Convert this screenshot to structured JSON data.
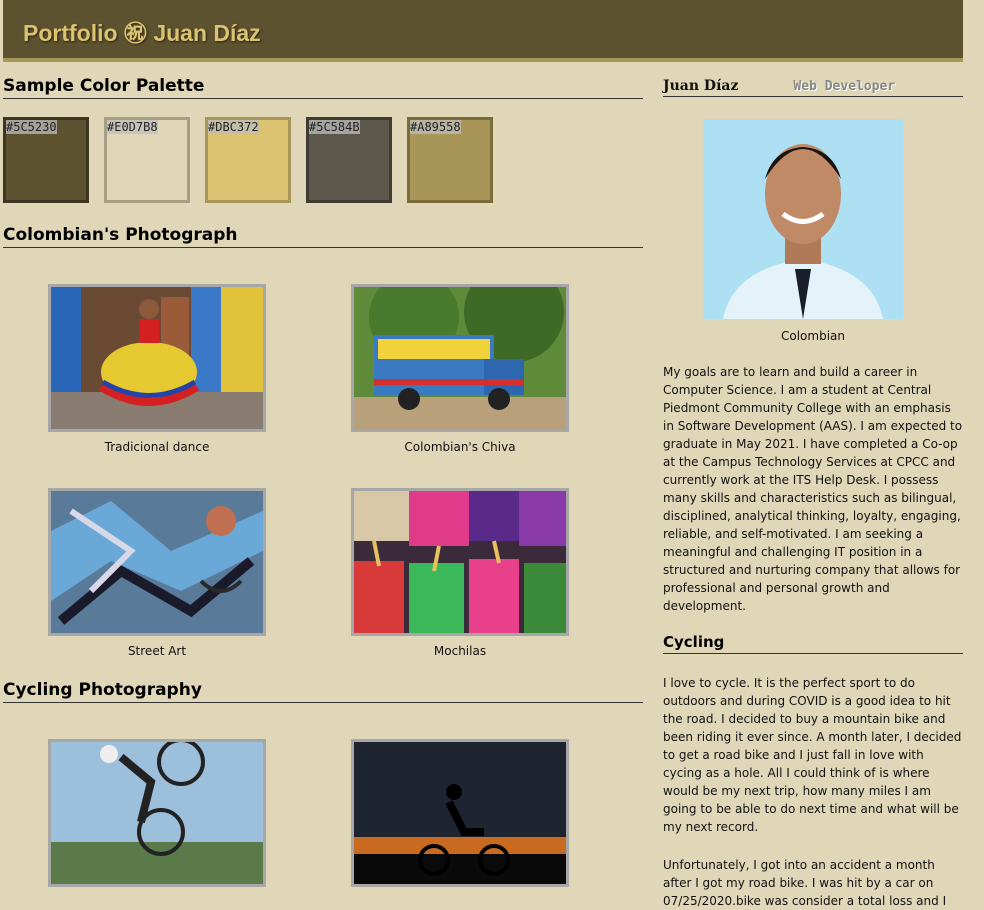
{
  "header": {
    "title": "Portfolio ㊗ Juan Díaz"
  },
  "palette": {
    "heading": "Sample Color Palette",
    "swatches": [
      {
        "label": "#5C5230",
        "color": "#5C5230",
        "border": "#3d3620"
      },
      {
        "label": "#E0D7B8",
        "color": "#E0D7B8",
        "border": "#a89f86"
      },
      {
        "label": "#DBC372",
        "color": "#DBC372",
        "border": "#a89558"
      },
      {
        "label": "#5C584B",
        "color": "#5C584B",
        "border": "#3e3b31"
      },
      {
        "label": "#A89558",
        "color": "#A89558",
        "border": "#7a6b3b"
      }
    ]
  },
  "colombian": {
    "heading": "Colombian's Photograph",
    "photos": [
      {
        "caption": "Tradicional dance"
      },
      {
        "caption": "Colombian's Chiva"
      },
      {
        "caption": "Street Art"
      },
      {
        "caption": "Mochilas"
      }
    ]
  },
  "cycling_photos": {
    "heading": "Cycling Photography"
  },
  "profile": {
    "name": "Juan Díaz",
    "role": "Web Developer",
    "portrait_caption": "Colombian",
    "bio": "My goals are to learn and build a career in Computer Science. I am a student at Central Piedmont Community College with an emphasis in Software Development (AAS). I am expected to graduate in May 2021. I have completed a Co-op at the Campus Technology Services at CPCC and currently work at the ITS Help Desk. I possess many skills and characteristics such as bilingual, disciplined, analytical thinking, loyalty, engaging, reliable, and self-motivated. I am seeking a meaningful and challenging IT position in a structured and nurturing company that allows for professional and personal growth and development."
  },
  "cycling": {
    "heading": "Cycling",
    "para1": "I love to cycle. It is the perfect sport to do outdoors and during COVID is a good idea to hit the road. I decided to buy a mountain bike and been riding it ever since. A month later, I decided to get a road bike and I just fall in love with cycing as a hole. All I could think of is where would be my next trip, how many miles I am going to be able to do next time and what will be my next record.",
    "para2": "Unfortunately, I got into an accident a month after I got my road bike. I was hit by a car on 07/25/2020.bike was consider a total loss and I"
  }
}
